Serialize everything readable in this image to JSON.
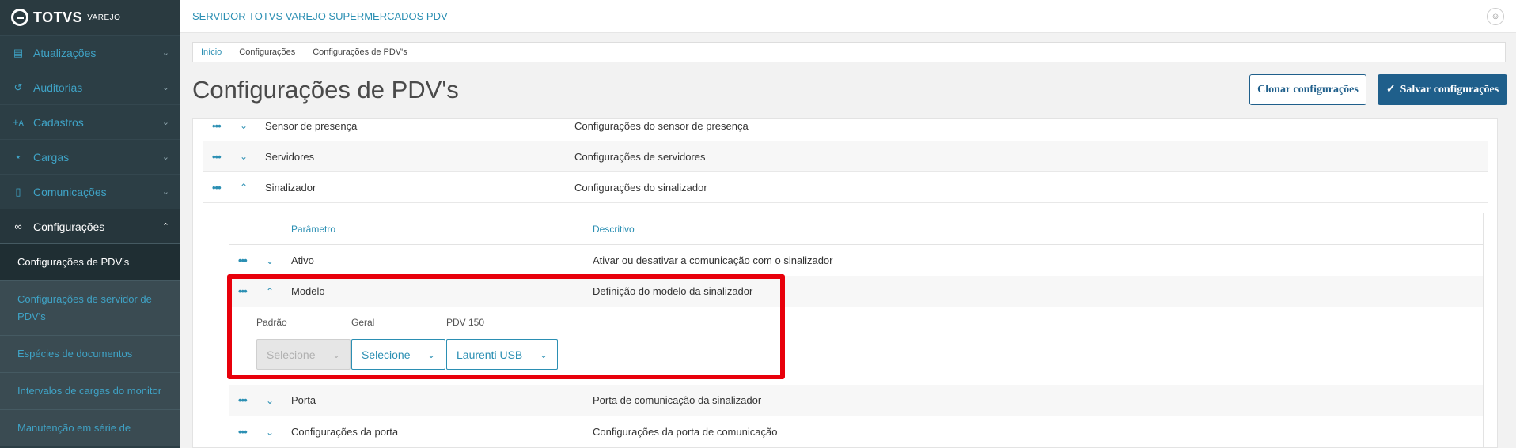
{
  "brand": {
    "name": "TOTVS",
    "sub": "VAREJO"
  },
  "sidebar": {
    "items": [
      {
        "label": "Atualizações",
        "icon": "card-icon"
      },
      {
        "label": "Auditorias",
        "icon": "history-icon"
      },
      {
        "label": "Cadastros",
        "icon": "add-user-icon"
      },
      {
        "label": "Cargas",
        "icon": "share-icon"
      },
      {
        "label": "Comunicações",
        "icon": "device-icon"
      },
      {
        "label": "Configurações",
        "icon": "link-icon"
      }
    ],
    "submenu": [
      "Configurações de PDV's",
      "Configurações de servidor de PDV's",
      "Espécies de documentos",
      "Intervalos de cargas do monitor",
      "Manutenção em série de"
    ]
  },
  "topbar": {
    "app_title": "SERVIDOR TOTVS VAREJO SUPERMERCADOS PDV"
  },
  "breadcrumb": [
    "Início",
    "Configurações",
    "Configurações de PDV's"
  ],
  "page": {
    "title": "Configurações de PDV's",
    "clone_label": "Clonar configurações",
    "save_label": "Salvar configurações"
  },
  "groups": [
    {
      "name": "Sensor de presença",
      "desc": "Configurações do sensor de presença"
    },
    {
      "name": "Servidores",
      "desc": "Configurações de servidores"
    },
    {
      "name": "Sinalizador",
      "desc": "Configurações do sinalizador"
    }
  ],
  "inner": {
    "col_param": "Parâmetro",
    "col_desc": "Descritivo",
    "rows": [
      {
        "name": "Ativo",
        "desc": "Ativar ou desativar a comunicação com o sinalizador"
      },
      {
        "name": "Modelo",
        "desc": "Definição do modelo da sinalizador"
      },
      {
        "name": "Porta",
        "desc": "Porta de comunicação da sinalizador"
      },
      {
        "name": "Configurações da porta",
        "desc": "Configurações da porta de comunicação"
      }
    ],
    "fields": [
      {
        "label": "Padrão",
        "value": "Selecione"
      },
      {
        "label": "Geral",
        "value": "Selecione"
      },
      {
        "label": "PDV 150",
        "value": "Laurenti USB"
      }
    ]
  },
  "colors": {
    "accent": "#2b8fb3",
    "primary": "#1f5f8b",
    "highlight": "#e8000b",
    "sidebar": "#2c3e45"
  }
}
